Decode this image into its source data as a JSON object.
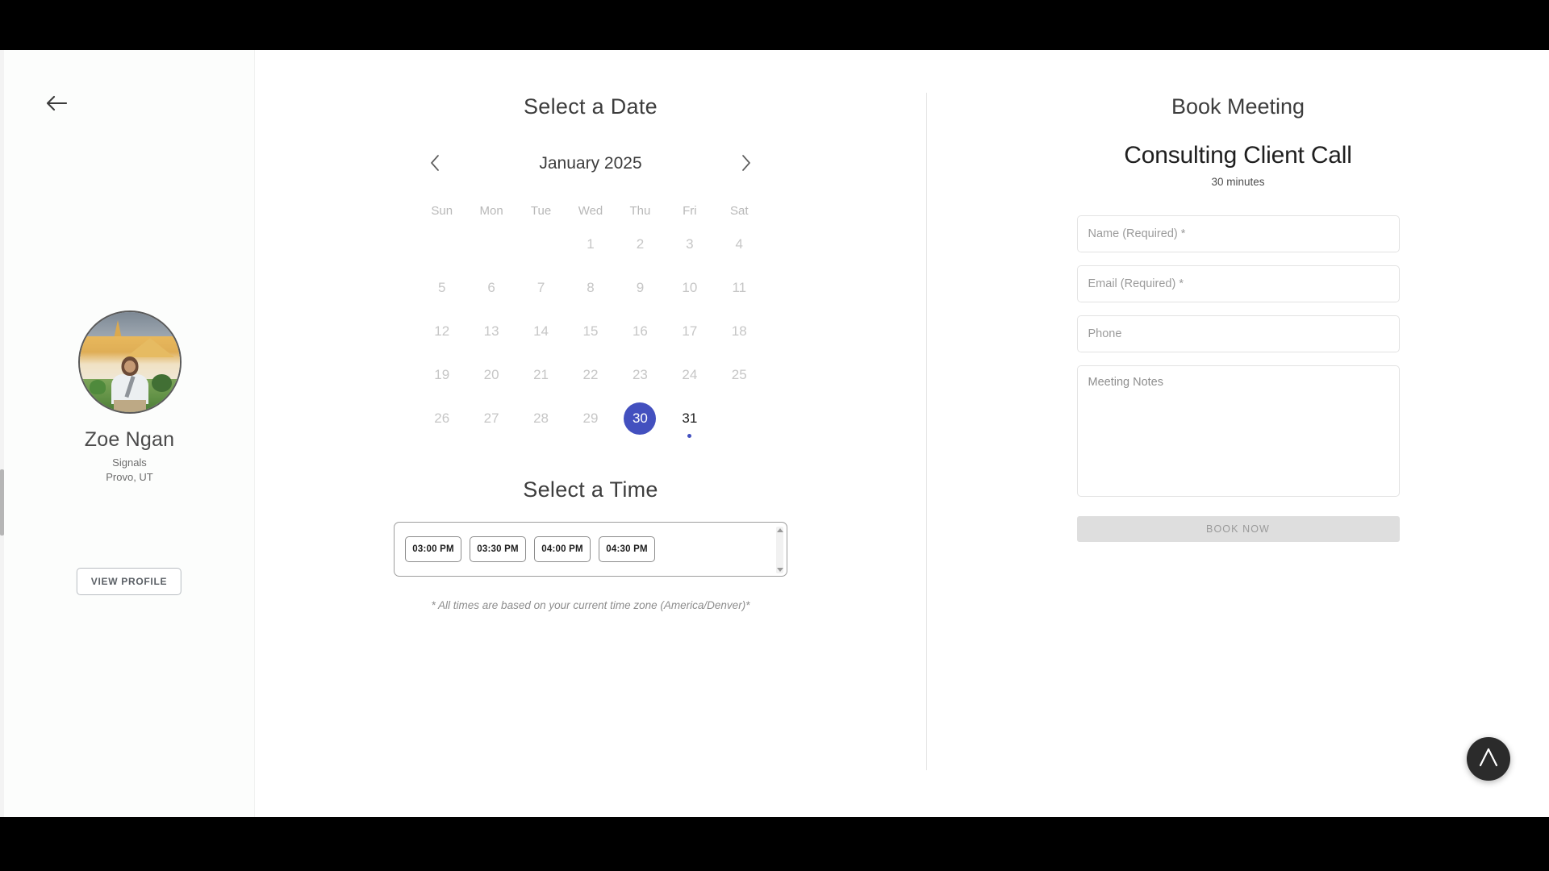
{
  "profile": {
    "back_icon": "arrow-left-icon",
    "name": "Zoe Ngan",
    "company": "Signals",
    "location": "Provo, UT",
    "view_profile_label": "VIEW PROFILE"
  },
  "calendar": {
    "title": "Select a Date",
    "prev_icon": "chevron-left-icon",
    "next_icon": "chevron-right-icon",
    "month_label": "January 2025",
    "day_headers": [
      "Sun",
      "Mon",
      "Tue",
      "Wed",
      "Thu",
      "Fri",
      "Sat"
    ],
    "lead_blanks": 3,
    "days": [
      {
        "n": "1",
        "state": "disabled"
      },
      {
        "n": "2",
        "state": "disabled"
      },
      {
        "n": "3",
        "state": "disabled"
      },
      {
        "n": "4",
        "state": "disabled"
      },
      {
        "n": "5",
        "state": "disabled"
      },
      {
        "n": "6",
        "state": "disabled"
      },
      {
        "n": "7",
        "state": "disabled"
      },
      {
        "n": "8",
        "state": "disabled"
      },
      {
        "n": "9",
        "state": "disabled"
      },
      {
        "n": "10",
        "state": "disabled"
      },
      {
        "n": "11",
        "state": "disabled"
      },
      {
        "n": "12",
        "state": "disabled"
      },
      {
        "n": "13",
        "state": "disabled"
      },
      {
        "n": "14",
        "state": "disabled"
      },
      {
        "n": "15",
        "state": "disabled"
      },
      {
        "n": "16",
        "state": "disabled"
      },
      {
        "n": "17",
        "state": "disabled"
      },
      {
        "n": "18",
        "state": "disabled"
      },
      {
        "n": "19",
        "state": "disabled"
      },
      {
        "n": "20",
        "state": "disabled"
      },
      {
        "n": "21",
        "state": "disabled"
      },
      {
        "n": "22",
        "state": "disabled"
      },
      {
        "n": "23",
        "state": "disabled"
      },
      {
        "n": "24",
        "state": "disabled"
      },
      {
        "n": "25",
        "state": "disabled"
      },
      {
        "n": "26",
        "state": "disabled"
      },
      {
        "n": "27",
        "state": "disabled"
      },
      {
        "n": "28",
        "state": "disabled"
      },
      {
        "n": "29",
        "state": "disabled"
      },
      {
        "n": "30",
        "state": "selected"
      },
      {
        "n": "31",
        "state": "available",
        "dot": true
      }
    ],
    "selected_day": "30",
    "accent_color": "#4350bf"
  },
  "time_picker": {
    "title": "Select a Time",
    "slots": [
      "03:00 PM",
      "03:30 PM",
      "04:00 PM",
      "04:30 PM"
    ],
    "scroll_up_icon": "caret-up-icon",
    "scroll_down_icon": "caret-down-icon",
    "timezone_note": "* All times are based on your current time zone (America/Denver)*"
  },
  "booking": {
    "title": "Book Meeting",
    "event_name": "Consulting Client Call",
    "duration": "30 minutes",
    "fields": {
      "name_placeholder": "Name (Required) *",
      "name_value": "",
      "email_placeholder": "Email (Required) *",
      "email_value": "",
      "phone_placeholder": "Phone",
      "phone_value": "",
      "notes_placeholder": "Meeting Notes",
      "notes_value": ""
    },
    "submit_label": "BOOK NOW"
  },
  "badge": {
    "icon": "lambda-logo-icon"
  }
}
